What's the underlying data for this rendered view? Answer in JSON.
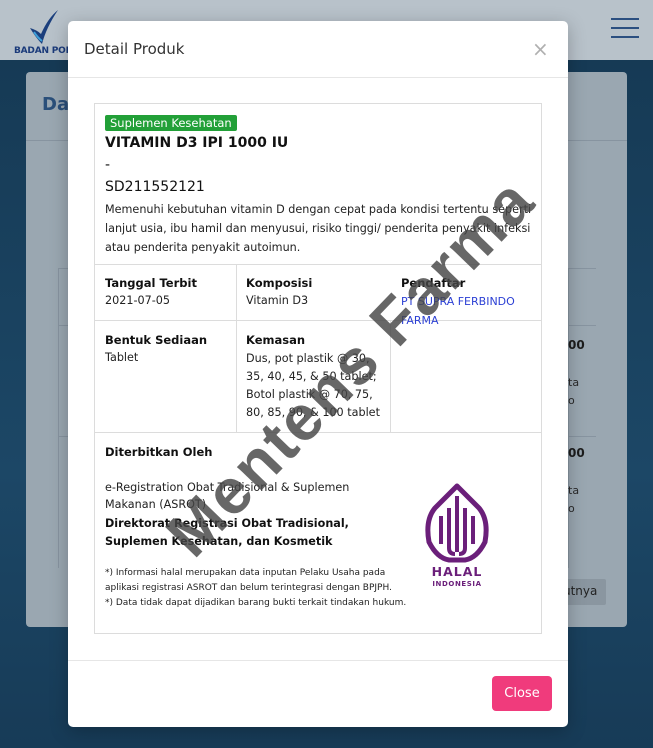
{
  "background": {
    "logo_text": "BADAN POM",
    "card_title": "Da",
    "row1_value": "00",
    "row1_detail": [
      "ta",
      "o"
    ],
    "row2_value": "00",
    "row2_detail": [
      "ta",
      "o"
    ],
    "next_label": "utnya"
  },
  "modal": {
    "title": "Detail Produk",
    "close_icon": "×",
    "close_button": "Close",
    "category_badge": "Suplemen Kesehatan",
    "product_name": "VITAMIN D3 IPI 1000 IU",
    "product_dash": "-",
    "product_code": "SD211552121",
    "description": "Memenuhi kebutuhan vitamin D dengan cepat pada kondisi tertentu seperti lanjut usia, ibu hamil dan menyusui, risiko tinggi/ penderita penyakit infeksi atau penderita penyakit autoimun.",
    "fields": {
      "tanggal_label": "Tanggal Terbit",
      "tanggal_value": "2021-07-05",
      "komposisi_label": "Komposisi",
      "komposisi_value": "Vitamin D3",
      "pendaftar_label": "Pendaftar",
      "pendaftar_value": "PT SUPRA FERBINDO FARMA",
      "bentuk_label": "Bentuk Sediaan",
      "bentuk_value": "Tablet",
      "kemasan_label": "Kemasan",
      "kemasan_value": "Dus, pot plastik @ 30, 35, 40, 45, & 50 tablet; Botol plastik @ 70, 75, 80, 85, 90, & 100 tablet"
    },
    "issued_label": "Diterbitkan Oleh",
    "issued_org": "e-Registration Obat Tradisional & Suplemen Makanan (ASROT)",
    "issued_directorate": "Direktorat Registrasi Obat Tradisional, Suplemen Kesehatan, dan Kosmetik",
    "footnote_1": "*) Informasi halal merupakan data inputan Pelaku Usaha pada aplikasi registrasi ASROT dan belum terintegrasi dengan BPJPH.",
    "footnote_2": "*) Data tidak dapat dijadikan barang bukti terkait tindakan hukum.",
    "halal_text": "HALAL",
    "halal_subtext": "INDONESIA"
  },
  "watermark": "Mentens Farma",
  "colors": {
    "badge": "#22a038",
    "close_button": "#f03b7c",
    "link": "#2b3fd4",
    "halal": "#6b1f7a"
  }
}
